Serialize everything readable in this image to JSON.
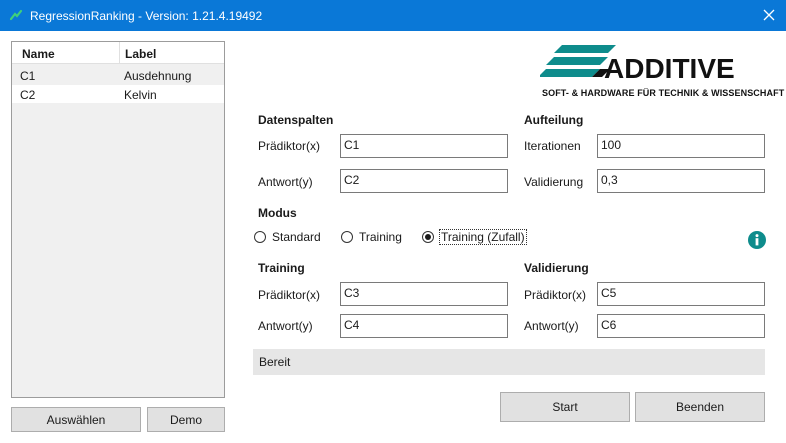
{
  "window": {
    "title": "RegressionRanking - Version: 1.21.4.19492"
  },
  "list": {
    "headers": {
      "name": "Name",
      "label": "Label"
    },
    "rows": [
      {
        "name": "C1",
        "label": "Ausdehnung"
      },
      {
        "name": "C2",
        "label": "Kelvin"
      }
    ]
  },
  "buttons": {
    "select": "Auswählen",
    "demo": "Demo",
    "start": "Start",
    "quit": "Beenden"
  },
  "logo": {
    "name": "ADDITIVE",
    "tagline": "SOFT- & HARDWARE FÜR TECHNIK & WISSENSCHAFT",
    "color": "#0e8c8c"
  },
  "datenspalten": {
    "title": "Datenspalten",
    "predictor_label": "Prädiktor(x)",
    "predictor_value": "C1",
    "response_label": "Antwort(y)",
    "response_value": "C2"
  },
  "aufteilung": {
    "title": "Aufteilung",
    "iterations_label": "Iterationen",
    "iterations_value": "100",
    "validation_label": "Validierung",
    "validation_value": "0,3"
  },
  "modus": {
    "title": "Modus",
    "options": [
      {
        "label": "Standard",
        "selected": false
      },
      {
        "label": "Training",
        "selected": false
      },
      {
        "label": "Training (Zufall)",
        "selected": true
      }
    ]
  },
  "training": {
    "title": "Training",
    "predictor_label": "Prädiktor(x)",
    "predictor_value": "C3",
    "response_label": "Antwort(y)",
    "response_value": "C4"
  },
  "validierung": {
    "title": "Validierung",
    "predictor_label": "Prädiktor(x)",
    "predictor_value": "C5",
    "response_label": "Antwort(y)",
    "response_value": "C6"
  },
  "status": {
    "text": "Bereit"
  },
  "colors": {
    "titlebar": "#0a78d7",
    "info": "#0e8c8c"
  },
  "icons": {
    "app": "app-icon",
    "close": "close-icon",
    "info": "info-icon"
  }
}
